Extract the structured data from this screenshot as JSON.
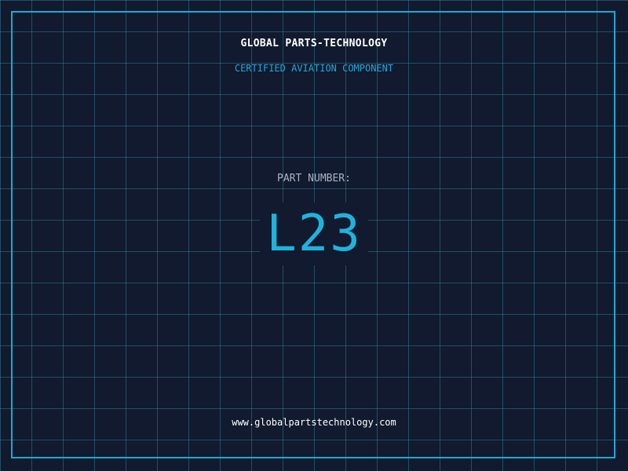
{
  "brand": {
    "title": "GLOBAL PARTS-TECHNOLOGY",
    "subtitle": "CERTIFIED AVIATION COMPONENT"
  },
  "part": {
    "label": "PART NUMBER:",
    "number": "L23"
  },
  "footer": {
    "website": "www.globalpartstechnology.com"
  },
  "colors": {
    "background": "#111a2e",
    "grid": "#3a8caa",
    "accent": "#1fb3dc",
    "title": "#ffffff",
    "label": "#a8b4c4"
  }
}
